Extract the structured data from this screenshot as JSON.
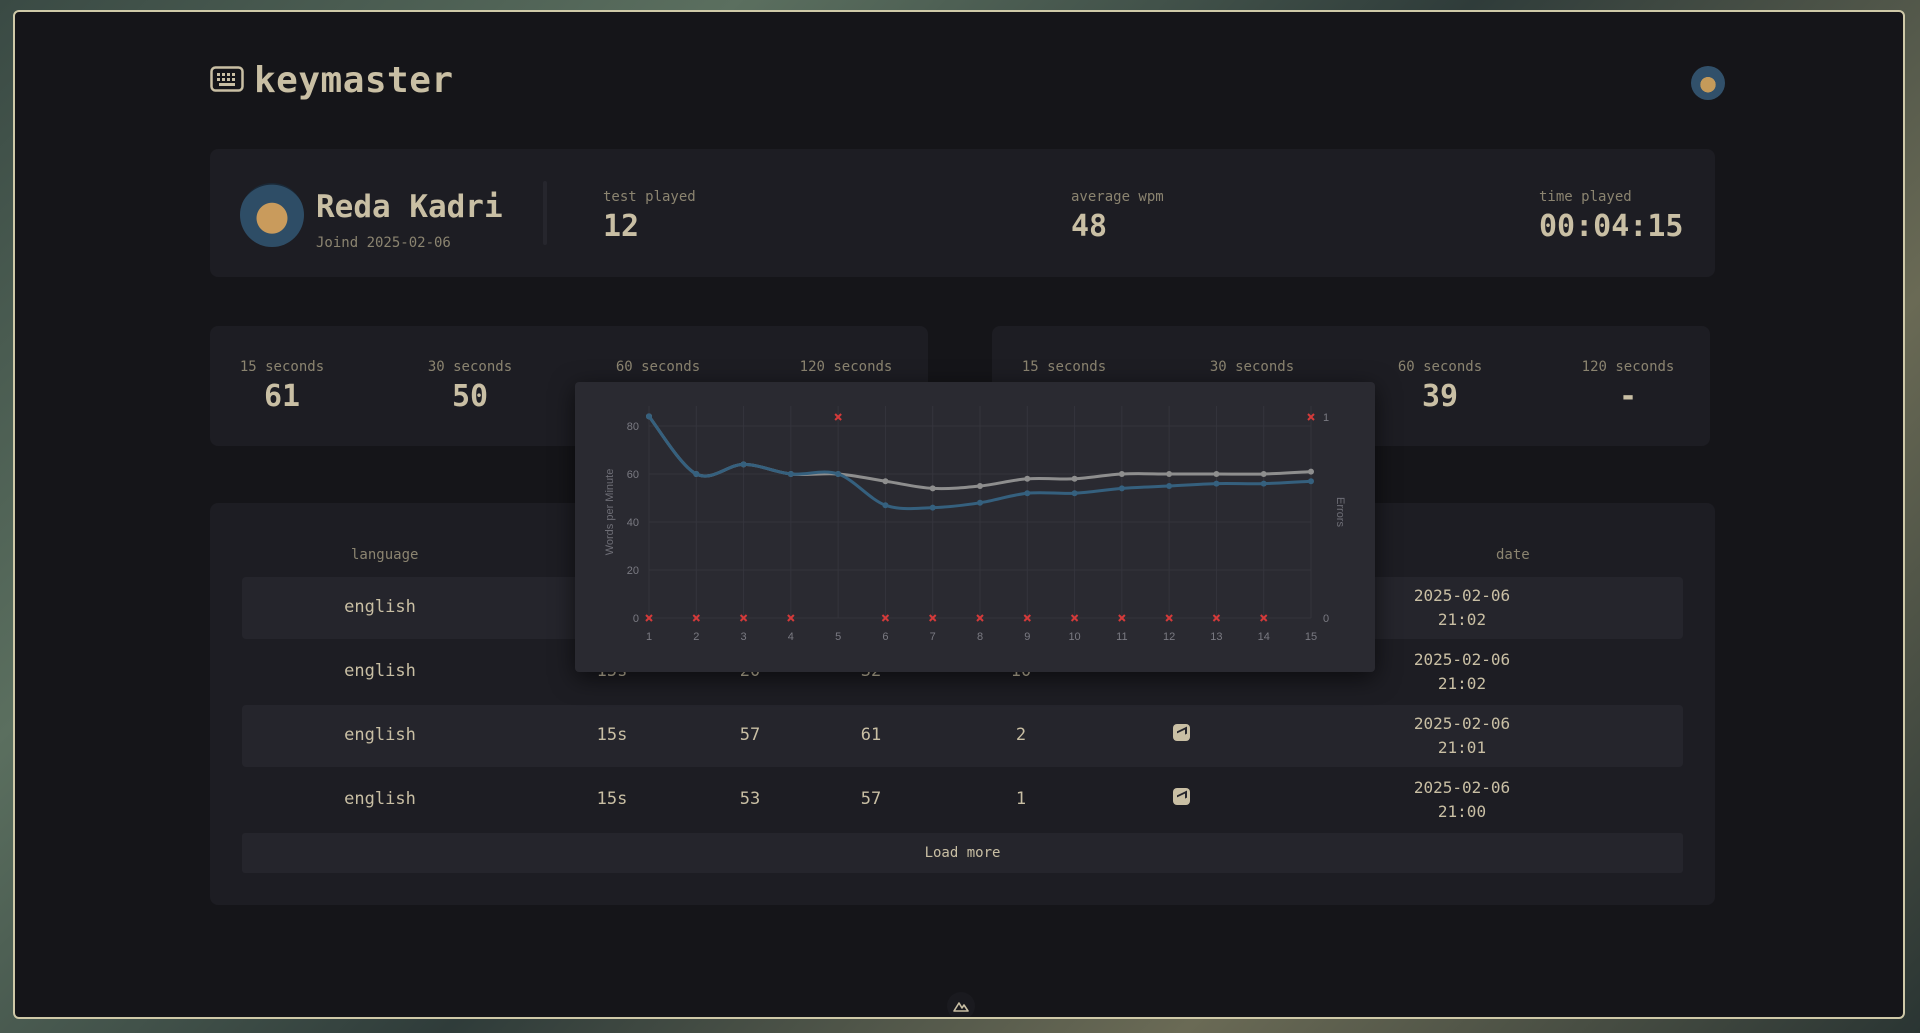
{
  "app": {
    "name": "keymaster"
  },
  "profile": {
    "name": "Reda Kadri",
    "joined": "Joind 2025-02-06",
    "stats": [
      {
        "label": "test played",
        "value": "12"
      },
      {
        "label": "average wpm",
        "value": "48"
      },
      {
        "label": "time played",
        "value": "00:04:15"
      }
    ]
  },
  "wpm_left": [
    {
      "label": "15 seconds",
      "value": "61"
    },
    {
      "label": "30 seconds",
      "value": "50"
    },
    {
      "label": "60 seconds",
      "value": ""
    },
    {
      "label": "120 seconds",
      "value": ""
    }
  ],
  "wpm_right": [
    {
      "label": "15 seconds",
      "value": ""
    },
    {
      "label": "30 seconds",
      "value": ""
    },
    {
      "label": "60 seconds",
      "value": "39"
    },
    {
      "label": "120 seconds",
      "value": "-"
    }
  ],
  "history": {
    "headers": {
      "language": "language",
      "date": "date"
    },
    "rows": [
      {
        "language": "english",
        "duration": "",
        "raw": "",
        "wpm": "",
        "errors": "",
        "date_line1": "2025-02-06",
        "date_line2": "21:02"
      },
      {
        "language": "english",
        "duration": "15s",
        "raw": "20",
        "wpm": "32",
        "errors": "10",
        "date_line1": "2025-02-06",
        "date_line2": "21:02"
      },
      {
        "language": "english",
        "duration": "15s",
        "raw": "57",
        "wpm": "61",
        "errors": "2",
        "date_line1": "2025-02-06",
        "date_line2": "21:01"
      },
      {
        "language": "english",
        "duration": "15s",
        "raw": "53",
        "wpm": "57",
        "errors": "1",
        "date_line1": "2025-02-06",
        "date_line2": "21:00"
      }
    ],
    "load_more": "Load more"
  },
  "chart_data": {
    "type": "line",
    "x": [
      1,
      2,
      3,
      4,
      5,
      6,
      7,
      8,
      9,
      10,
      11,
      12,
      13,
      14,
      15
    ],
    "ylabel": "Words per Minute",
    "y2label": "Errors",
    "ylim": [
      0,
      80
    ],
    "y2lim": [
      0,
      1
    ],
    "yticks": [
      0,
      20,
      40,
      60,
      80
    ],
    "y2ticks": [
      0,
      1
    ],
    "grid": true,
    "series": [
      {
        "values": [
          84,
          60,
          64,
          60,
          60,
          57,
          54,
          55,
          58,
          58,
          60,
          60,
          60,
          60,
          61
        ],
        "color": "#8e8e8e"
      },
      {
        "values": [
          84,
          60,
          64,
          60,
          60,
          47,
          46,
          48,
          52,
          52,
          54,
          55,
          56,
          56,
          57
        ],
        "color": "#35607e"
      },
      {
        "values": [
          0,
          0,
          0,
          0,
          1,
          0,
          0,
          0,
          0,
          0,
          0,
          0,
          0,
          0,
          1
        ],
        "color": "#d33a3a",
        "axis": "y2",
        "marker": "x"
      }
    ]
  }
}
